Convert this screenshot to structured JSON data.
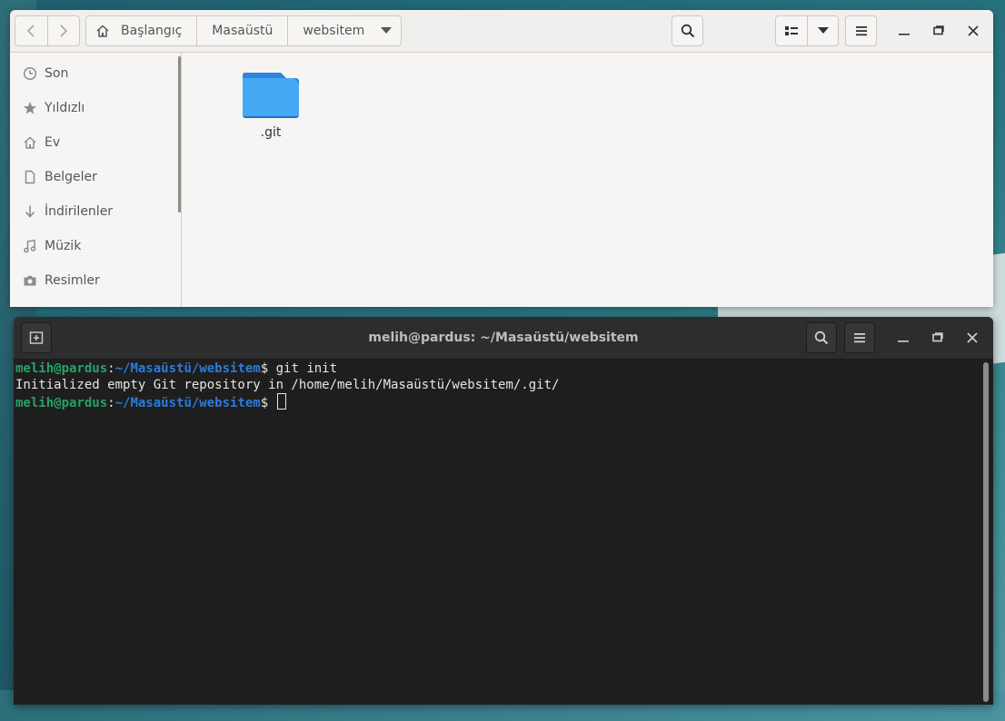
{
  "file_manager": {
    "breadcrumbs": [
      "Başlangıç",
      "Masaüstü",
      "websitem"
    ],
    "sidebar": [
      {
        "label": "Son",
        "icon": "clock-icon"
      },
      {
        "label": "Yıldızlı",
        "icon": "star-icon"
      },
      {
        "label": "Ev",
        "icon": "home-icon"
      },
      {
        "label": "Belgeler",
        "icon": "document-icon"
      },
      {
        "label": "İndirilenler",
        "icon": "download-icon"
      },
      {
        "label": "Müzik",
        "icon": "music-icon"
      },
      {
        "label": "Resimler",
        "icon": "camera-icon"
      }
    ],
    "files": [
      {
        "name": ".git",
        "icon": "folder-icon"
      }
    ]
  },
  "terminal": {
    "title": "melih@pardus: ~/Masaüstü/websitem",
    "lines": [
      {
        "user": "melih@pardus",
        "sep": ":",
        "path": "~/Masaüstü/websitem",
        "prompt": "$ ",
        "cmd": "git init"
      },
      {
        "output": "Initialized empty Git repository in /home/melih/Masaüstü/websitem/.git/"
      },
      {
        "user": "melih@pardus",
        "sep": ":",
        "path": "~/Masaüstü/websitem",
        "prompt": "$ ",
        "cmd": ""
      }
    ]
  },
  "colors": {
    "prompt_user": "#26a269",
    "prompt_path": "#2a7bde",
    "folder": "#3d9bf0"
  }
}
